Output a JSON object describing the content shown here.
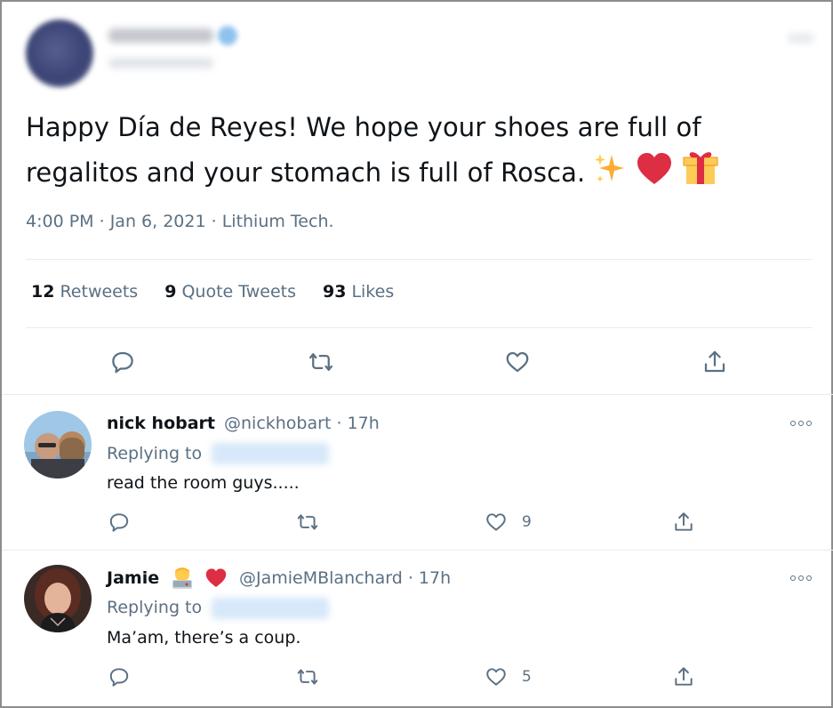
{
  "tweet": {
    "text_line1": "Happy Día de Reyes! We hope your shoes are full of",
    "text_line2": "regalitos and your stomach is full of Rosca.",
    "emojis": [
      "sparkles-icon",
      "red-heart-icon",
      "gift-icon"
    ],
    "time": "4:00 PM",
    "date": "Jan 6, 2021",
    "source": "Lithium Tech.",
    "sep": "·",
    "stats": {
      "retweets_count": "12",
      "retweets_label": "Retweets",
      "quotes_count": "9",
      "quotes_label": "Quote Tweets",
      "likes_count": "93",
      "likes_label": "Likes"
    }
  },
  "replies": [
    {
      "name": "nick hobart",
      "handle_line": "@nickhobart · 17h",
      "replying_label": "Replying to",
      "text": "read the room guys.....",
      "likes": "9"
    },
    {
      "name": "Jamie",
      "handle_line": "@JamieMBlanchard · 17h",
      "replying_label": "Replying to",
      "text": "Ma’am, there’s a coup.",
      "likes": "5"
    }
  ],
  "colors": {
    "text": "#0f1419",
    "secondary": "#5b7083",
    "divider": "#e6ecf0",
    "heart": "#e0245e"
  }
}
